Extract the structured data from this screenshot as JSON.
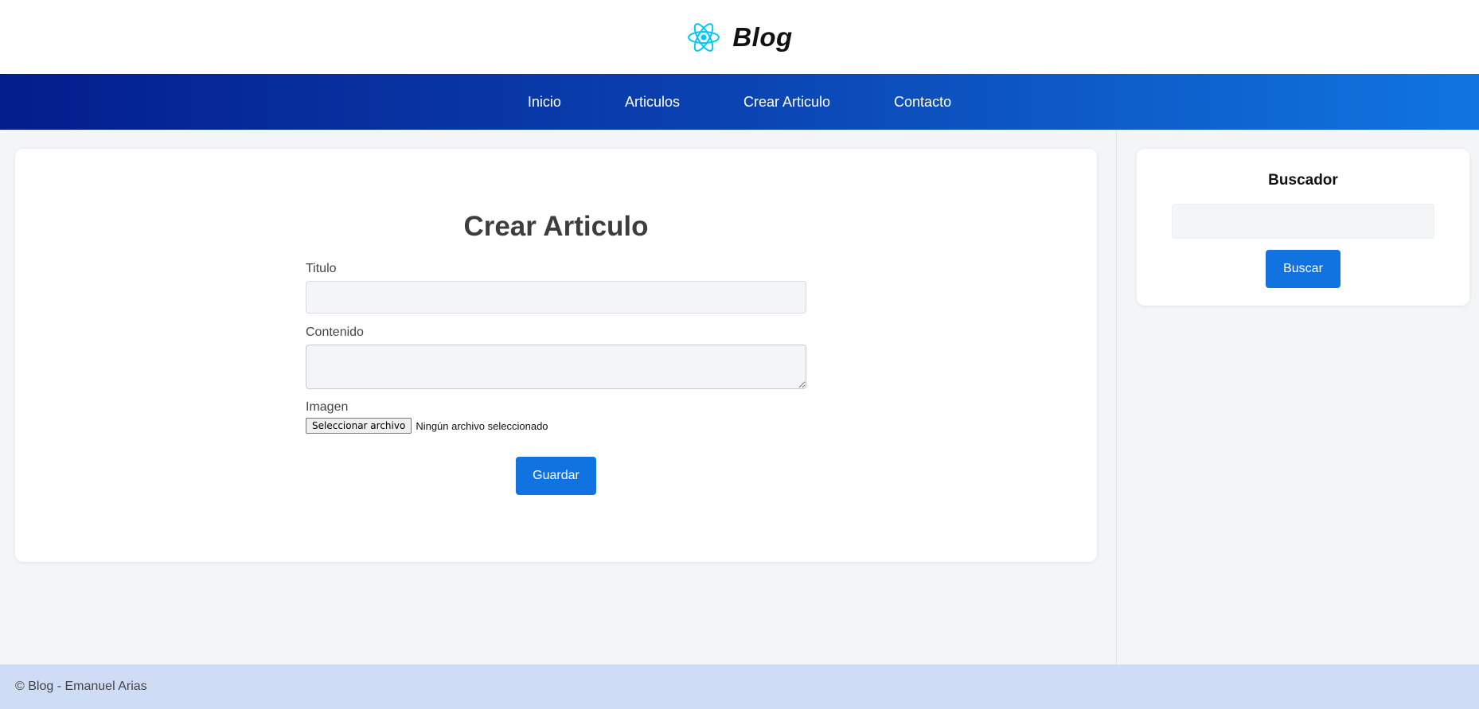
{
  "header": {
    "brand": "Blog",
    "logo_icon": "react-atom-icon",
    "logo_color": "#00c8f8"
  },
  "nav": {
    "items": [
      "Inicio",
      "Articulos",
      "Crear Articulo",
      "Contacto"
    ]
  },
  "main": {
    "title": "Crear Articulo",
    "titulo_label": "Titulo",
    "titulo_value": "",
    "contenido_label": "Contenido",
    "contenido_value": "",
    "imagen_label": "Imagen",
    "file_button_label": "Seleccionar archivo",
    "file_status": "Ningún archivo seleccionado",
    "save_label": "Guardar"
  },
  "sidebar": {
    "title": "Buscador",
    "search_value": "",
    "search_button_label": "Buscar"
  },
  "footer": {
    "text": "© Blog - Emanuel Arias"
  },
  "colors": {
    "accent": "#1173e0",
    "nav_gradient_start": "#041d8c",
    "nav_gradient_end": "#1075e0",
    "footer_bg": "#cfdcf5"
  }
}
